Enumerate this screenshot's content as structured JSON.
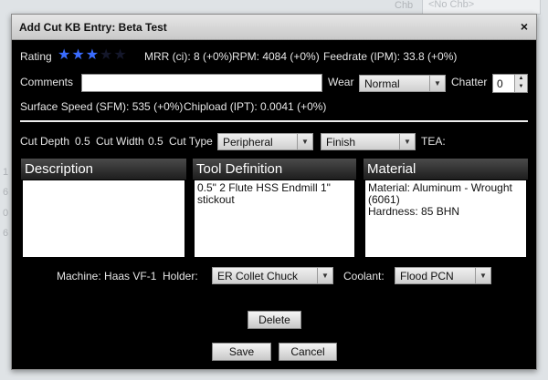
{
  "background": {
    "chb_label": "Chb",
    "chb_value": "<No Chb>",
    "row_digits": [
      "1",
      "6",
      "0",
      "6"
    ]
  },
  "dialog": {
    "title": "Add Cut KB Entry: Beta Test",
    "close_label": "×",
    "rating": {
      "label": "Rating",
      "value": 3,
      "max": 5,
      "star_on": "#3a6cff",
      "star_off": "#14172a"
    },
    "stats_line1": {
      "mrr": "MRR (ci): 8 (+0%)",
      "rpm": "RPM: 4084 (+0%)",
      "feedrate": "Feedrate (IPM): 33.8 (+0%)"
    },
    "comments": {
      "label": "Comments",
      "value": ""
    },
    "wear": {
      "label": "Wear",
      "value": "Normal"
    },
    "chatter": {
      "label": "Chatter",
      "value": "0"
    },
    "stats_line2": {
      "sfm": "Surface Speed (SFM): 535 (+0%)",
      "chipload": "Chipload (IPT): 0.0041 (+0%)"
    },
    "cut": {
      "depth_label": "Cut Depth",
      "depth": "0.5",
      "width_label": "Cut Width",
      "width": "0.5",
      "type_label": "Cut Type",
      "type_value": "Peripheral",
      "finish_value": "Finish",
      "tea_label": "TEA:"
    },
    "panels": {
      "description": {
        "title": "Description",
        "body": ""
      },
      "tool": {
        "title": "Tool Definition",
        "body": "0.5\" 2 Flute HSS Endmill  1\"\nstickout"
      },
      "material": {
        "title": "Material",
        "body": "Material: Aluminum - Wrought\n(6061)\nHardness: 85 BHN"
      }
    },
    "machine": {
      "label": "Machine: Haas VF-1",
      "holder_label": "Holder:",
      "holder_value": "ER Collet Chuck",
      "coolant_label": "Coolant:",
      "coolant_value": "Flood PCN"
    },
    "buttons": {
      "delete": "Delete",
      "save": "Save",
      "cancel": "Cancel"
    }
  }
}
